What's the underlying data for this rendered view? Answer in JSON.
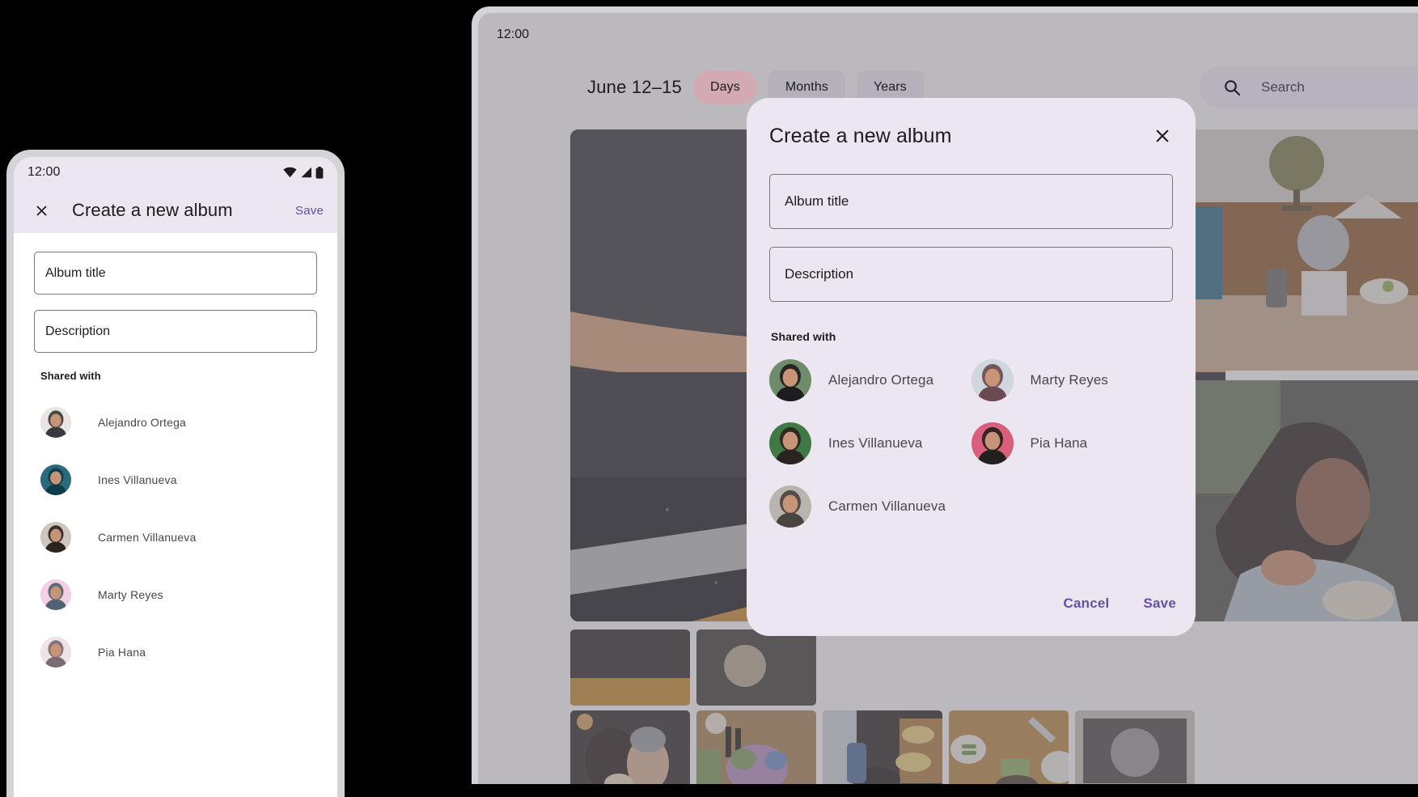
{
  "phone": {
    "status": {
      "clock": "12:00",
      "icons": [
        "wifi-icon",
        "signal-icon",
        "battery-icon"
      ]
    },
    "appbar": {
      "close_icon": "close-icon",
      "title": "Create a new album",
      "save_label": "Save"
    },
    "fields": [
      {
        "name": "album-title-input",
        "value": "Album title"
      },
      {
        "name": "description-input",
        "value": "Description"
      }
    ],
    "shared_label": "Shared with",
    "contacts": [
      {
        "name": "Alejandro Ortega",
        "c1": "#e9e6e2",
        "c2": "#3a3a3c"
      },
      {
        "name": "Ines Villanueva",
        "c1": "#2b6a7d",
        "c2": "#0d3b49"
      },
      {
        "name": "Carmen Villanueva",
        "c1": "#cfc7bd",
        "c2": "#2a2320"
      },
      {
        "name": "Marty Reyes",
        "c1": "#f5cfe2",
        "c2": "#4f6272"
      },
      {
        "name": "Pia Hana",
        "c1": "#efe3ea",
        "c2": "#7a6a72"
      }
    ]
  },
  "tablet": {
    "status": {
      "clock": "12:00"
    },
    "topbar": {
      "date_range": "June 12–15",
      "chips": [
        {
          "label": "Days",
          "selected": true
        },
        {
          "label": "Months",
          "selected": false
        },
        {
          "label": "Years",
          "selected": false
        }
      ],
      "search_icon": "search-icon",
      "search_placeholder": "Search"
    },
    "dialog": {
      "title": "Create a new album",
      "close_icon": "close-icon",
      "fields": [
        {
          "name": "album-title-input",
          "value": "Album title"
        },
        {
          "name": "description-input",
          "value": "Description"
        }
      ],
      "shared_label": "Shared with",
      "contacts": [
        {
          "name": "Alejandro Ortega",
          "c1": "#6f8c6a",
          "c2": "#1d1d1f"
        },
        {
          "name": "Marty Reyes",
          "c1": "#cfd6dd",
          "c2": "#6b4a52"
        },
        {
          "name": "Ines Villanueva",
          "c1": "#3f7a46",
          "c2": "#2a2320"
        },
        {
          "name": "Pia Hana",
          "c1": "#d95f7a",
          "c2": "#22201f"
        },
        {
          "name": "Carmen Villanueva",
          "c1": "#b9b5ae",
          "c2": "#4a4440"
        }
      ],
      "cancel_label": "Cancel",
      "save_label": "Save"
    }
  },
  "colors": {
    "accent_purple": "#6750a4",
    "surface_container": "#ece6f0",
    "chip_selected": "#d3a9b4",
    "scrim": "#78747e",
    "device_bezel": "#d4d3d8",
    "page_background": "#000000"
  }
}
